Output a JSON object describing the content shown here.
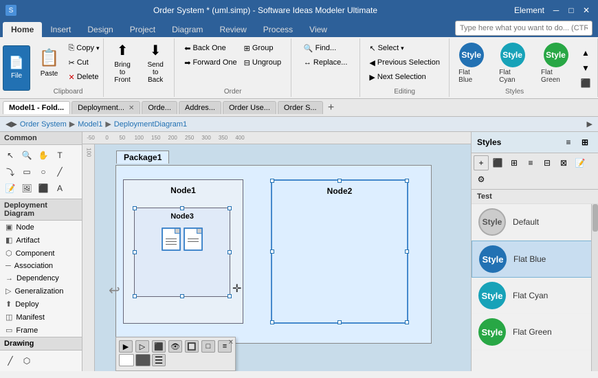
{
  "titleBar": {
    "title": "Order System * (uml.simp) - Software Ideas Modeler Ultimate",
    "rightLabel": "Element",
    "minBtn": "─",
    "maxBtn": "□",
    "closeBtn": "✕"
  },
  "quickAccess": {
    "buttons": [
      "⊞",
      "💾",
      "↩",
      "↪"
    ]
  },
  "ribbonTabs": {
    "tabs": [
      "File",
      "Home",
      "Insert",
      "Design",
      "Project",
      "Diagram",
      "Review",
      "Process",
      "View"
    ],
    "activeTab": "Home"
  },
  "searchBox": {
    "placeholder": "Type here what you want to do... (CTRL+Q)"
  },
  "ribbon": {
    "clipboard": {
      "label": "Clipboard",
      "paste": "Paste",
      "copy": "Copy",
      "cut": "Cut",
      "delete": "Delete"
    },
    "bringFront": {
      "label": "Bring to Front"
    },
    "sendBack": {
      "label": "Send to Back"
    },
    "order": {
      "label": "Order",
      "backOne": "Back One",
      "forwardOne": "Forward One",
      "group": "Group",
      "ungroup": "Ungroup"
    },
    "find": {
      "findLabel": "Find...",
      "replaceLabel": "Replace..."
    },
    "select": {
      "label": "Select",
      "previousSelection": "Previous Selection",
      "nextSelection": "Next Selection"
    },
    "editing": {
      "label": "Editing"
    },
    "styles": {
      "label": "Styles",
      "style1": "Style",
      "style2": "Style",
      "style3": "Style",
      "flatBlue": "Flat Blue",
      "flatCyan": "Flat Cyan",
      "flatGreen": "Flat Green"
    }
  },
  "tabs": {
    "items": [
      {
        "label": "Model1 - Fold...",
        "active": true,
        "closeable": false
      },
      {
        "label": "Deployment...",
        "active": false,
        "closeable": true
      },
      {
        "label": "Orde...",
        "active": false,
        "closeable": false
      },
      {
        "label": "Addres...",
        "active": false,
        "closeable": false
      },
      {
        "label": "Order Use...",
        "active": false,
        "closeable": false
      },
      {
        "label": "Order S...",
        "active": false,
        "closeable": false
      }
    ]
  },
  "breadcrumb": {
    "items": [
      "Order System",
      "Model1",
      "DeploymentDiagram1"
    ]
  },
  "sidebar": {
    "commonLabel": "Common",
    "deploymentLabel": "Deployment Diagram",
    "items": [
      {
        "icon": "▣",
        "label": "Node"
      },
      {
        "icon": "◧",
        "label": "Artifact"
      },
      {
        "icon": "⬡",
        "label": "Component"
      },
      {
        "icon": "─",
        "label": "Association"
      },
      {
        "icon": "→",
        "label": "Dependency"
      },
      {
        "icon": "▷",
        "label": "Generalization"
      },
      {
        "icon": "⬆",
        "label": "Deploy"
      },
      {
        "icon": "◫",
        "label": "Manifest"
      },
      {
        "icon": "▭",
        "label": "Frame"
      }
    ],
    "drawingLabel": "Drawing"
  },
  "canvas": {
    "packageLabel": "Package1",
    "node1Label": "Node1",
    "node2Label": "Node2",
    "node3Label": "Node3"
  },
  "rightPanel": {
    "title": "Styles",
    "sectionLabel": "Test",
    "styles": [
      {
        "name": "Default",
        "circle": "default",
        "label": "Default"
      },
      {
        "name": "Flat Blue",
        "circle": "blue",
        "label": "Flat Blue"
      },
      {
        "name": "Flat Cyan",
        "circle": "cyan",
        "label": "Flat Cyan"
      },
      {
        "name": "Flat Green",
        "circle": "green",
        "label": "Flat Green"
      }
    ]
  }
}
